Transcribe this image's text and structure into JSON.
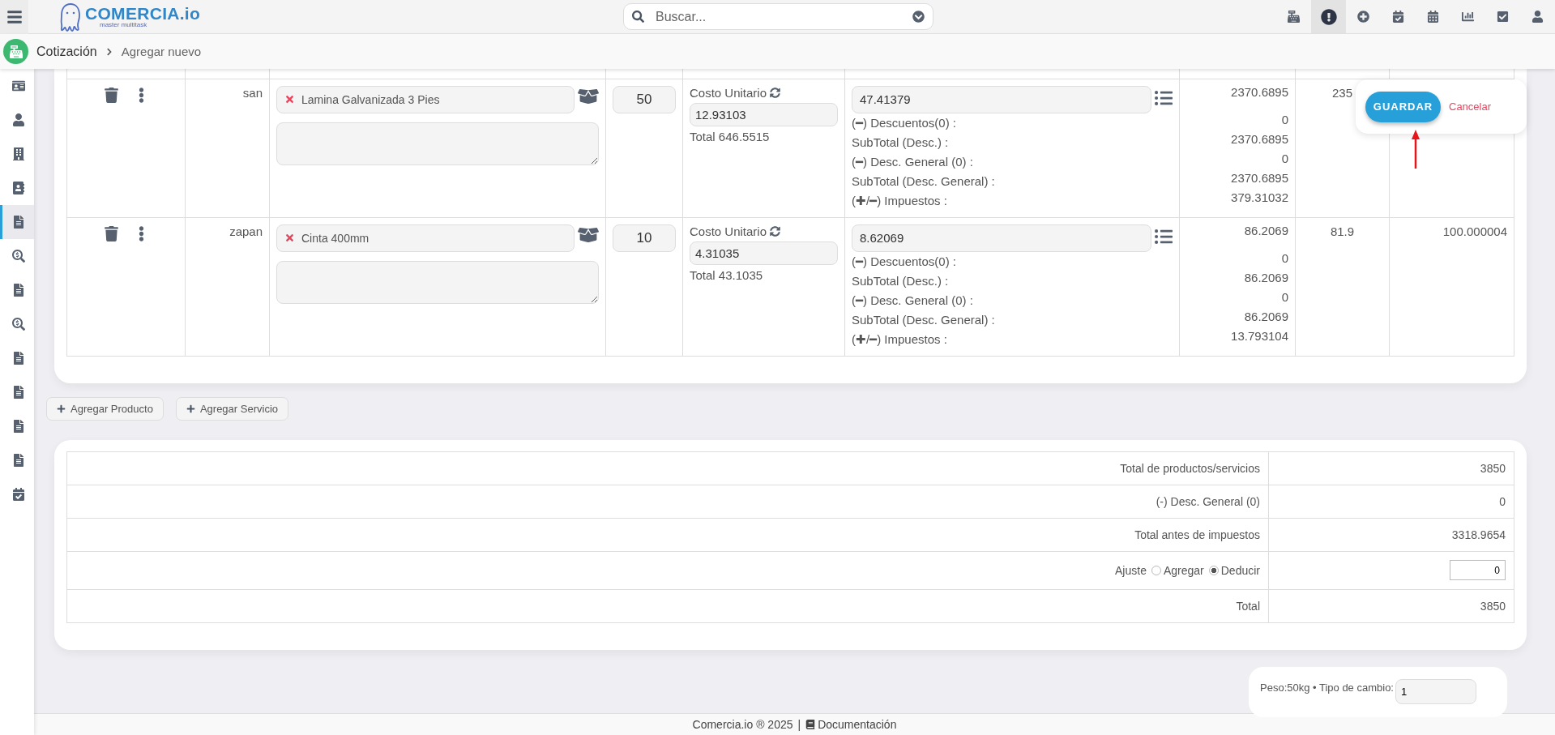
{
  "topbar": {
    "brand": "COMERCIA.io",
    "tagline": "master multitask",
    "search": {
      "placeholder": "Buscar..."
    },
    "icons": [
      {
        "selected": false
      },
      {
        "selected": true
      },
      {
        "selected": false
      },
      {
        "selected": false
      },
      {
        "selected": false
      },
      {
        "selected": false
      },
      {
        "selected": false
      },
      {
        "selected": false
      }
    ]
  },
  "breadcrumb": [
    "Cotización",
    "Agregar nuevo"
  ],
  "sidebar": {
    "items": [
      {
        "selected": false
      },
      {
        "selected": false
      },
      {
        "selected": false
      },
      {
        "selected": false
      },
      {
        "selected": true
      },
      {
        "selected": false
      },
      {
        "selected": false
      },
      {
        "selected": false
      },
      {
        "selected": false
      },
      {
        "selected": false
      },
      {
        "selected": false
      },
      {
        "selected": false
      },
      {
        "selected": false
      }
    ]
  },
  "products": {
    "rows": [
      {
        "code": "san",
        "product": "Lamina Galvanizada 3 Pies",
        "quantity": "50",
        "cost_label": "Costo Unitario",
        "cost": "12.93103",
        "cost_total": "Total 646.5515",
        "price": "47.41379",
        "breakdown": [
          "(━) Descuentos(0) :",
          "SubTotal (Desc.) :",
          "(━) Desc. General (0) :",
          "SubTotal (Desc. General) :",
          "(✚/━) Impuestos :"
        ],
        "amounts": [
          "2370.6895",
          "0",
          "2370.6895",
          "0",
          "2370.6895",
          "379.31032"
        ],
        "column_8": "235"
      },
      {
        "code": "zapan",
        "product": "Cinta 400mm",
        "quantity": "10",
        "cost_label": "Costo Unitario",
        "cost": "4.31035",
        "cost_total": "Total 43.1035",
        "price": "8.62069",
        "breakdown": [
          "(━) Descuentos(0) :",
          "SubTotal (Desc.) :",
          "(━) Desc. General (0) :",
          "SubTotal (Desc. General) :",
          "(✚/━) Impuestos :"
        ],
        "amounts": [
          "86.2069",
          "0",
          "86.2069",
          "0",
          "86.2069",
          "13.793104"
        ],
        "column_8": "81.9",
        "column_9": "100.000004"
      }
    ]
  },
  "add_buttons": [
    "Agregar Producto",
    "Agregar Servicio"
  ],
  "summary": [
    {
      "kind": "plain",
      "label": "Total de productos/servicios",
      "value": "3850"
    },
    {
      "kind": "plain",
      "label": "(-) Desc. General (0)",
      "value": "0"
    },
    {
      "kind": "plain",
      "label": "Total antes de impuestos",
      "value": "3318.9654"
    },
    {
      "kind": "adjust",
      "label": "Ajuste",
      "options": [
        {
          "label": "Agregar",
          "selected": false
        },
        {
          "label": "Deducir",
          "selected": true
        }
      ],
      "value": "0"
    },
    {
      "kind": "plain",
      "label": "Total",
      "value": "3850"
    }
  ],
  "exchange": {
    "text": "Peso:50kg • Tipo de cambio:",
    "value": "1"
  },
  "actions": {
    "save": "GUARDAR",
    "cancel": "Cancelar"
  },
  "footer": {
    "copyright": "Comercia.io ® 2025",
    "separator": "|",
    "link": "Documentación"
  }
}
